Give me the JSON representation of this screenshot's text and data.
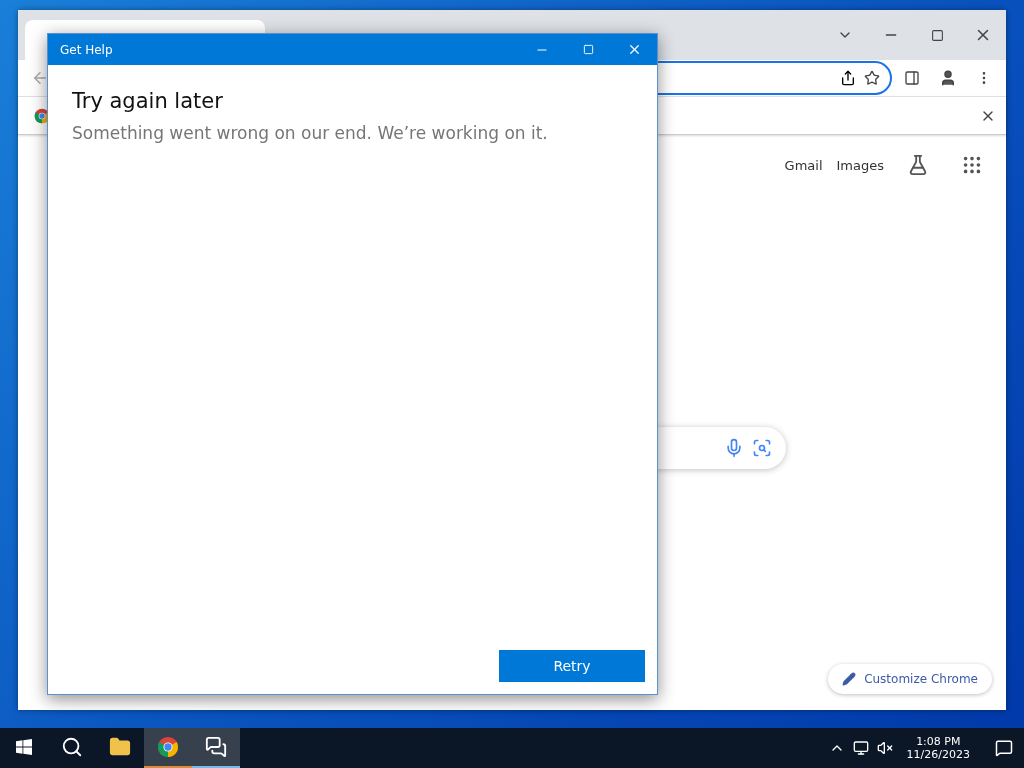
{
  "browser": {
    "top_links": [
      "Gmail",
      "Images"
    ],
    "customize_button": "Customize Chrome"
  },
  "dialog": {
    "title": "Get Help",
    "heading": "Try again later",
    "message": "Something went wrong on our end. We’re working on it.",
    "button": "Retry"
  },
  "taskbar": {
    "apps": [
      {
        "kind": "explorer",
        "running": false
      },
      {
        "kind": "chrome",
        "running": true
      },
      {
        "kind": "help",
        "running": true
      }
    ],
    "time": "1:08 PM",
    "date": "11/26/2023"
  }
}
